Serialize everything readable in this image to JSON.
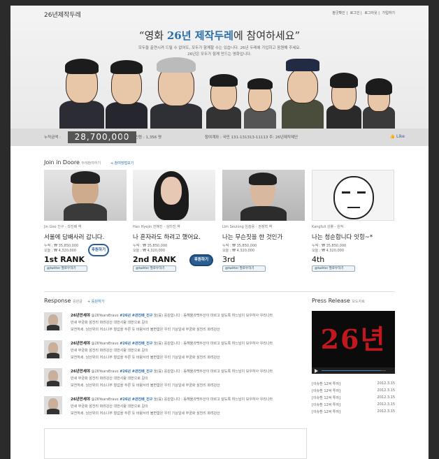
{
  "header": {
    "site_title": "26년제작두레",
    "links": [
      "참굿확인",
      "로그인",
      "로그아웃",
      "가입하기"
    ]
  },
  "hero": {
    "headline_open": "“영화 ",
    "headline_highlight": "26년 제작두레",
    "headline_close": "에 참여하세요”",
    "sub_line1": "모두들 출연시켜 드릴 수 없어도, 모두가 함께할 수는 있습니다. 26년 두레에 가입하고 응원해 주세요.",
    "sub_line2": "26년은 모두가 함께 만드는 영화입니다."
  },
  "counter": {
    "label": "누적금액 :",
    "amount": "28,700,000",
    "participants": "두레 참여인원 : 1,356 명",
    "account": "참여계좌 : 국민 131-131313-11113 주: 26년제작제단",
    "like": "Like"
  },
  "join": {
    "title": "Join in Doore",
    "title_small": "두레참여하기",
    "link": "+ 참여방법보기",
    "cards": [
      {
        "caption": "Jin Goo 진구 - 곽진배 역",
        "quote": "서울에 담배사러 갑니다.",
        "amount": "누적 : ₩ 35,850,000",
        "today": "오늘 : ₩ 4,320,000",
        "rank": "1st RANK",
        "twitter": "@twitter 팔로우하기"
      },
      {
        "caption": "Han Hyejin 한혜진 - 심미진 역",
        "quote": "나 혼자라도 하려고 했어요.",
        "amount": "누적 : ₩ 35,850,000",
        "today": "오늘 : ₩ 4,320,000",
        "rank": "2nd RANK",
        "twitter": "@twitter 팔로우하기"
      },
      {
        "caption": "Lim Seulong 임슬옹 - 권정혁 역",
        "quote": "나는 무슨짓을 한 것인가",
        "amount": "누적 : ₩ 35,850,000",
        "today": "오늘 : ₩ 4,320,000",
        "rank": "3rd",
        "twitter": "@twitter 팔로우하기"
      },
      {
        "caption": "Kangfull 강풀 - 원작",
        "quote": "나는 청순합니다 잇힝~*",
        "amount": "누적 : ₩ 35,850,000",
        "today": "오늘 : ₩ 4,320,000",
        "rank": "4th",
        "twitter": "@twitter 팔로우하기"
      }
    ],
    "bubble1": "후원하기",
    "bubble2": "후원하기"
  },
  "response": {
    "title": "Response",
    "title_small": "응원글",
    "link": "+ 응원하기",
    "items": [
      {
        "name": "26년만세야",
        "handle": "@26YearsBravo",
        "tag": "#26년 #관진배_진구",
        "line1": "을(를) 응원합니다 : 동해물과백두산이 마르고 닳도록 하느님이 보우하사 우리나라",
        "line2": "만세 무궁화 삼천리 화려강산 대한사람 대한으로 길이",
        "line3": "보전하세. 남산위의 저소나무 철갑을 두른 듯 바람서리 불변함은 우리 기상일세 무궁화 삼천리 화려강산"
      },
      {
        "name": "26년만세야",
        "handle": "@26YearsBravo",
        "tag": "#26년 #관진배_진구",
        "line1": "을(를) 응원합니다 : 동해물과백두산이 마르고 닳도록 하느님이 보우하사 우리나라",
        "line2": "만세 무궁화 삼천리 화려강산 대한사람 대한으로 길이",
        "line3": "보전하세. 남산위의 저소나무 철갑을 두른 듯 바람서리 불변함은 우리 기상일세 무궁화 삼천리 화려강산"
      },
      {
        "name": "26년만세야",
        "handle": "@26YearsBravo",
        "tag": "#26년 #관진배_진구",
        "line1": "을(를) 응원합니다 : 동해물과백두산이 마르고 닳도록 하느님이 보우하사 우리나라",
        "line2": "만세 무궁화 삼천리 화려강산 대한사람 대한으로 길이",
        "line3": "보전하세. 남산위의 저소나무 철갑을 두른 듯 바람서리 불변함은 우리 기상일세 무궁화 삼천리 화려강산"
      },
      {
        "name": "26년만세야",
        "handle": "@26YearsBravo",
        "tag": "#26년 #관진배_진구",
        "line1": "을(를) 응원합니다 : 동해물과백두산이 마르고 닳도록 하느님이 보우하사 우리나라",
        "line2": "만세 무궁화 삼천리 화려강산 대한사람 대한으로 길이",
        "line3": "보전하세. 남산위의 저소나무 철갑을 두른 듯 바람서리 불변함은 우리 기상일세 무궁화 삼천리 화려강산"
      }
    ]
  },
  "press": {
    "title": "Press Release",
    "title_small": "보도자료",
    "video_title": "26년",
    "progress": 0.92,
    "items": [
      {
        "text": "[이슈환 12억 투자]",
        "date": "2012.3.15"
      },
      {
        "text": "[이슈환 12억 투자]",
        "date": "2012.3.15"
      },
      {
        "text": "[이슈환 12억 투자]",
        "date": "2012.3.15"
      },
      {
        "text": "[이슈환 12억 투자]",
        "date": "2012.3.15"
      },
      {
        "text": "[이슈환 12억 투자]",
        "date": "2012.3.15"
      }
    ]
  },
  "colors": {
    "accent": "#2a6fa8",
    "bubble": "#2a5f93",
    "video_title": "#c0181c"
  }
}
